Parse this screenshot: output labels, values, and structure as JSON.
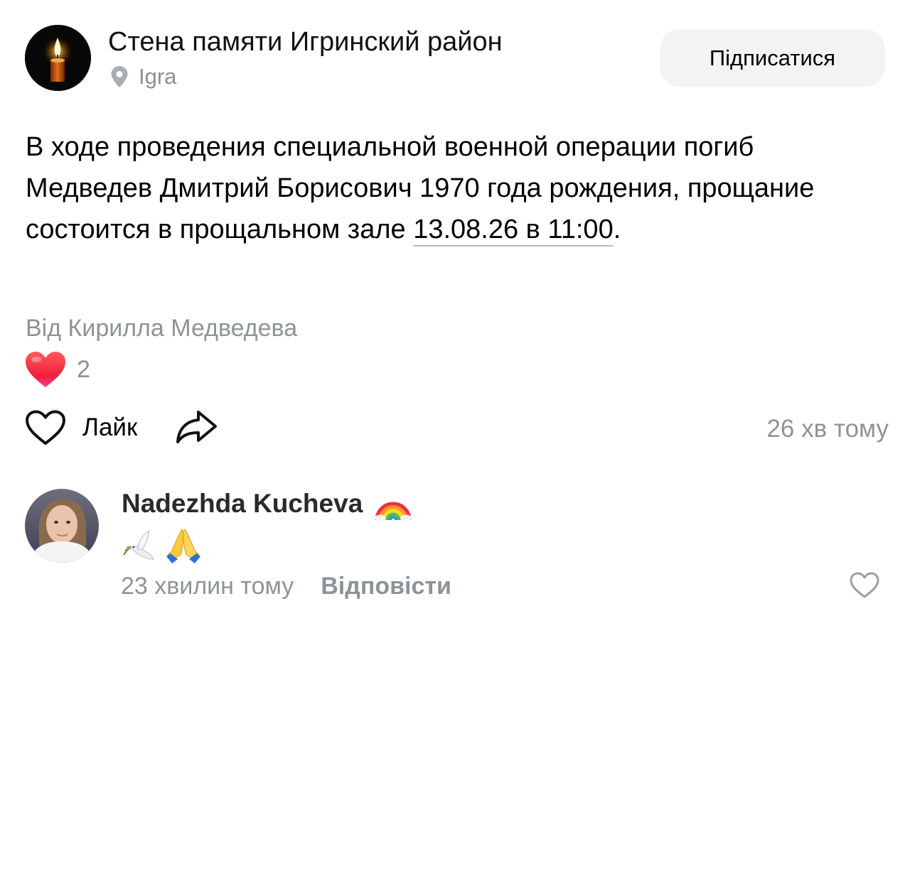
{
  "header": {
    "group_name": "Стена памяти Игринский район",
    "location": "Igra",
    "subscribe_label": "Підписатися"
  },
  "post": {
    "text_main": "В ходе проведения специальной военной операции погиб Медведев Дмитрий Борисович 1970 года рождения, прощание состоится в прощальном зале ",
    "text_date": "13.08.26 в 11:00",
    "text_end": ".",
    "author_line": "Від Кирилла Медведева",
    "reactions_count": "2",
    "like_label": "Лайк",
    "time": "26 хв тому"
  },
  "comment": {
    "author": "Nadezhda Kucheva",
    "time": "23 хвилин тому",
    "reply_label": "Відповісти"
  },
  "icons": {
    "location": "location-pin-icon",
    "reaction": "heart-reaction-icon",
    "like": "heart-outline-icon",
    "share": "share-arrow-icon",
    "author_badge": "rainbow-icon",
    "comment_emojis": [
      "dove-icon",
      "praying-hands-icon"
    ]
  },
  "colors": {
    "secondary_text": "#8e9399",
    "button_bg": "#f2f3f5",
    "reaction_red": "#ff3347"
  }
}
